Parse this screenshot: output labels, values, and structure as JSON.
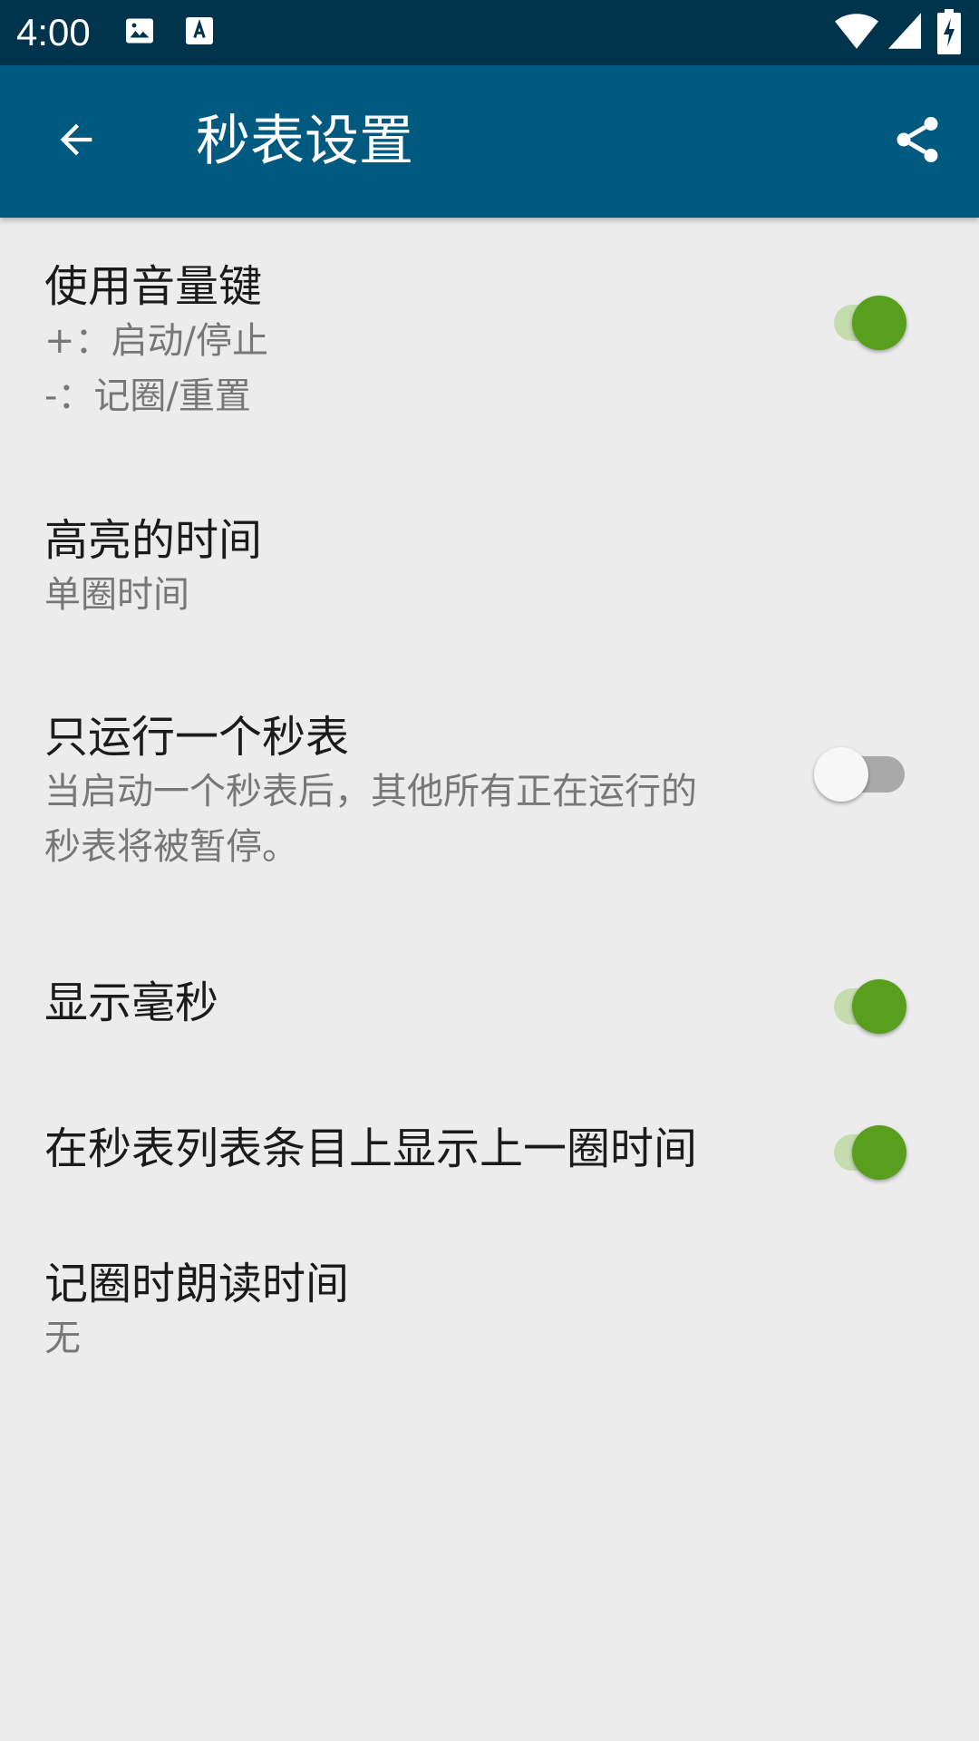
{
  "status_bar": {
    "time": "4:00",
    "icons": [
      "image-icon",
      "font-download-icon",
      "wifi-icon",
      "signal-icon",
      "battery-charging-icon"
    ]
  },
  "app_bar": {
    "title": "秒表设置",
    "back_icon": "arrow-back-icon",
    "share_icon": "share-icon",
    "background": "#005a80"
  },
  "settings": [
    {
      "title": "使用音量键",
      "summary_lines": [
        "+：启动/停止",
        "-：记圈/重置"
      ],
      "toggle": true
    },
    {
      "title": "高亮的时间",
      "summary_lines": [
        "单圈时间"
      ]
    },
    {
      "title": "只运行一个秒表",
      "summary_lines": [
        "当启动一个秒表后，其他所有正在运行的",
        "秒表将被暂停。"
      ],
      "toggle": false
    },
    {
      "title": "显示毫秒",
      "toggle": true
    },
    {
      "title": "在秒表列表条目上显示上一圈时间",
      "toggle": true
    },
    {
      "title": "记圈时朗读时间",
      "summary_lines": [
        "无"
      ]
    }
  ],
  "colors": {
    "toggle_on": "#579f1d",
    "toggle_on_track": "#c5dcaf",
    "toggle_off_thumb": "#f7f7f7",
    "toggle_off_track": "#a9a9a9",
    "status_bar": "#00344c"
  }
}
